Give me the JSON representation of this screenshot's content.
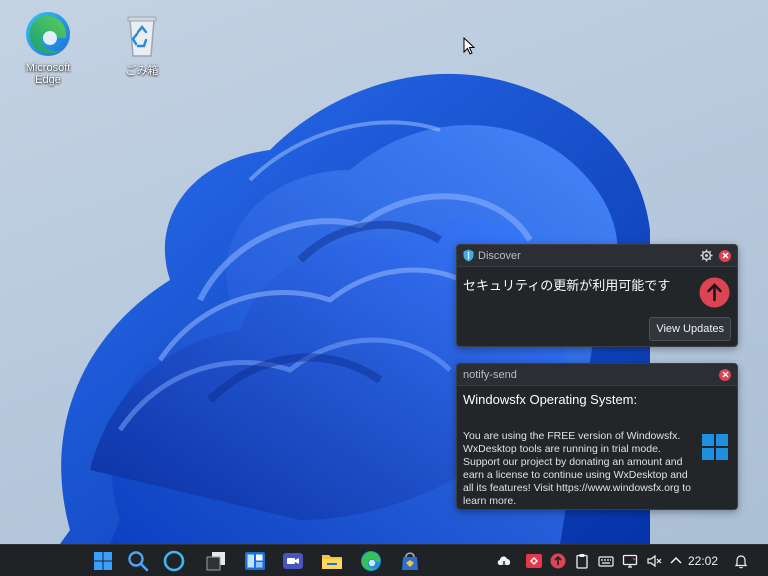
{
  "desktop": {
    "icons": [
      {
        "label": "Microsoft Edge",
        "icon": "edge-icon"
      },
      {
        "label": "ごみ箱",
        "icon": "recycle-bin-icon"
      }
    ]
  },
  "notifications": {
    "discover": {
      "app_name": "Discover",
      "title": "セキュリティの更新が利用可能です",
      "action_label": "View Updates",
      "accent": "#da4453"
    },
    "notify_send": {
      "app_name": "notify-send",
      "title": "Windowsfx Operating System:",
      "body": "You are using the FREE version of Windowsfx. WxDesktop tools are running in trial mode. Support our project by donating an amount and earn a license to continue using WxDesktop and all its features! Visit https://www.windowsfx.org to learn more."
    }
  },
  "taskbar": {
    "apps": [
      "start-icon",
      "search-icon",
      "cortana-icon",
      "task-view-icon",
      "widgets-icon",
      "teams-icon",
      "file-explorer-icon",
      "edge-icon",
      "store-icon"
    ],
    "tray": [
      "cloud-sync-icon",
      "anydesk-icon",
      "update-alert-icon",
      "clipboard-icon",
      "keyboard-icon",
      "network-icon",
      "volume-muted-icon",
      "chevron-up-icon"
    ],
    "clock": "22:02",
    "accent": "#0a74d9"
  }
}
